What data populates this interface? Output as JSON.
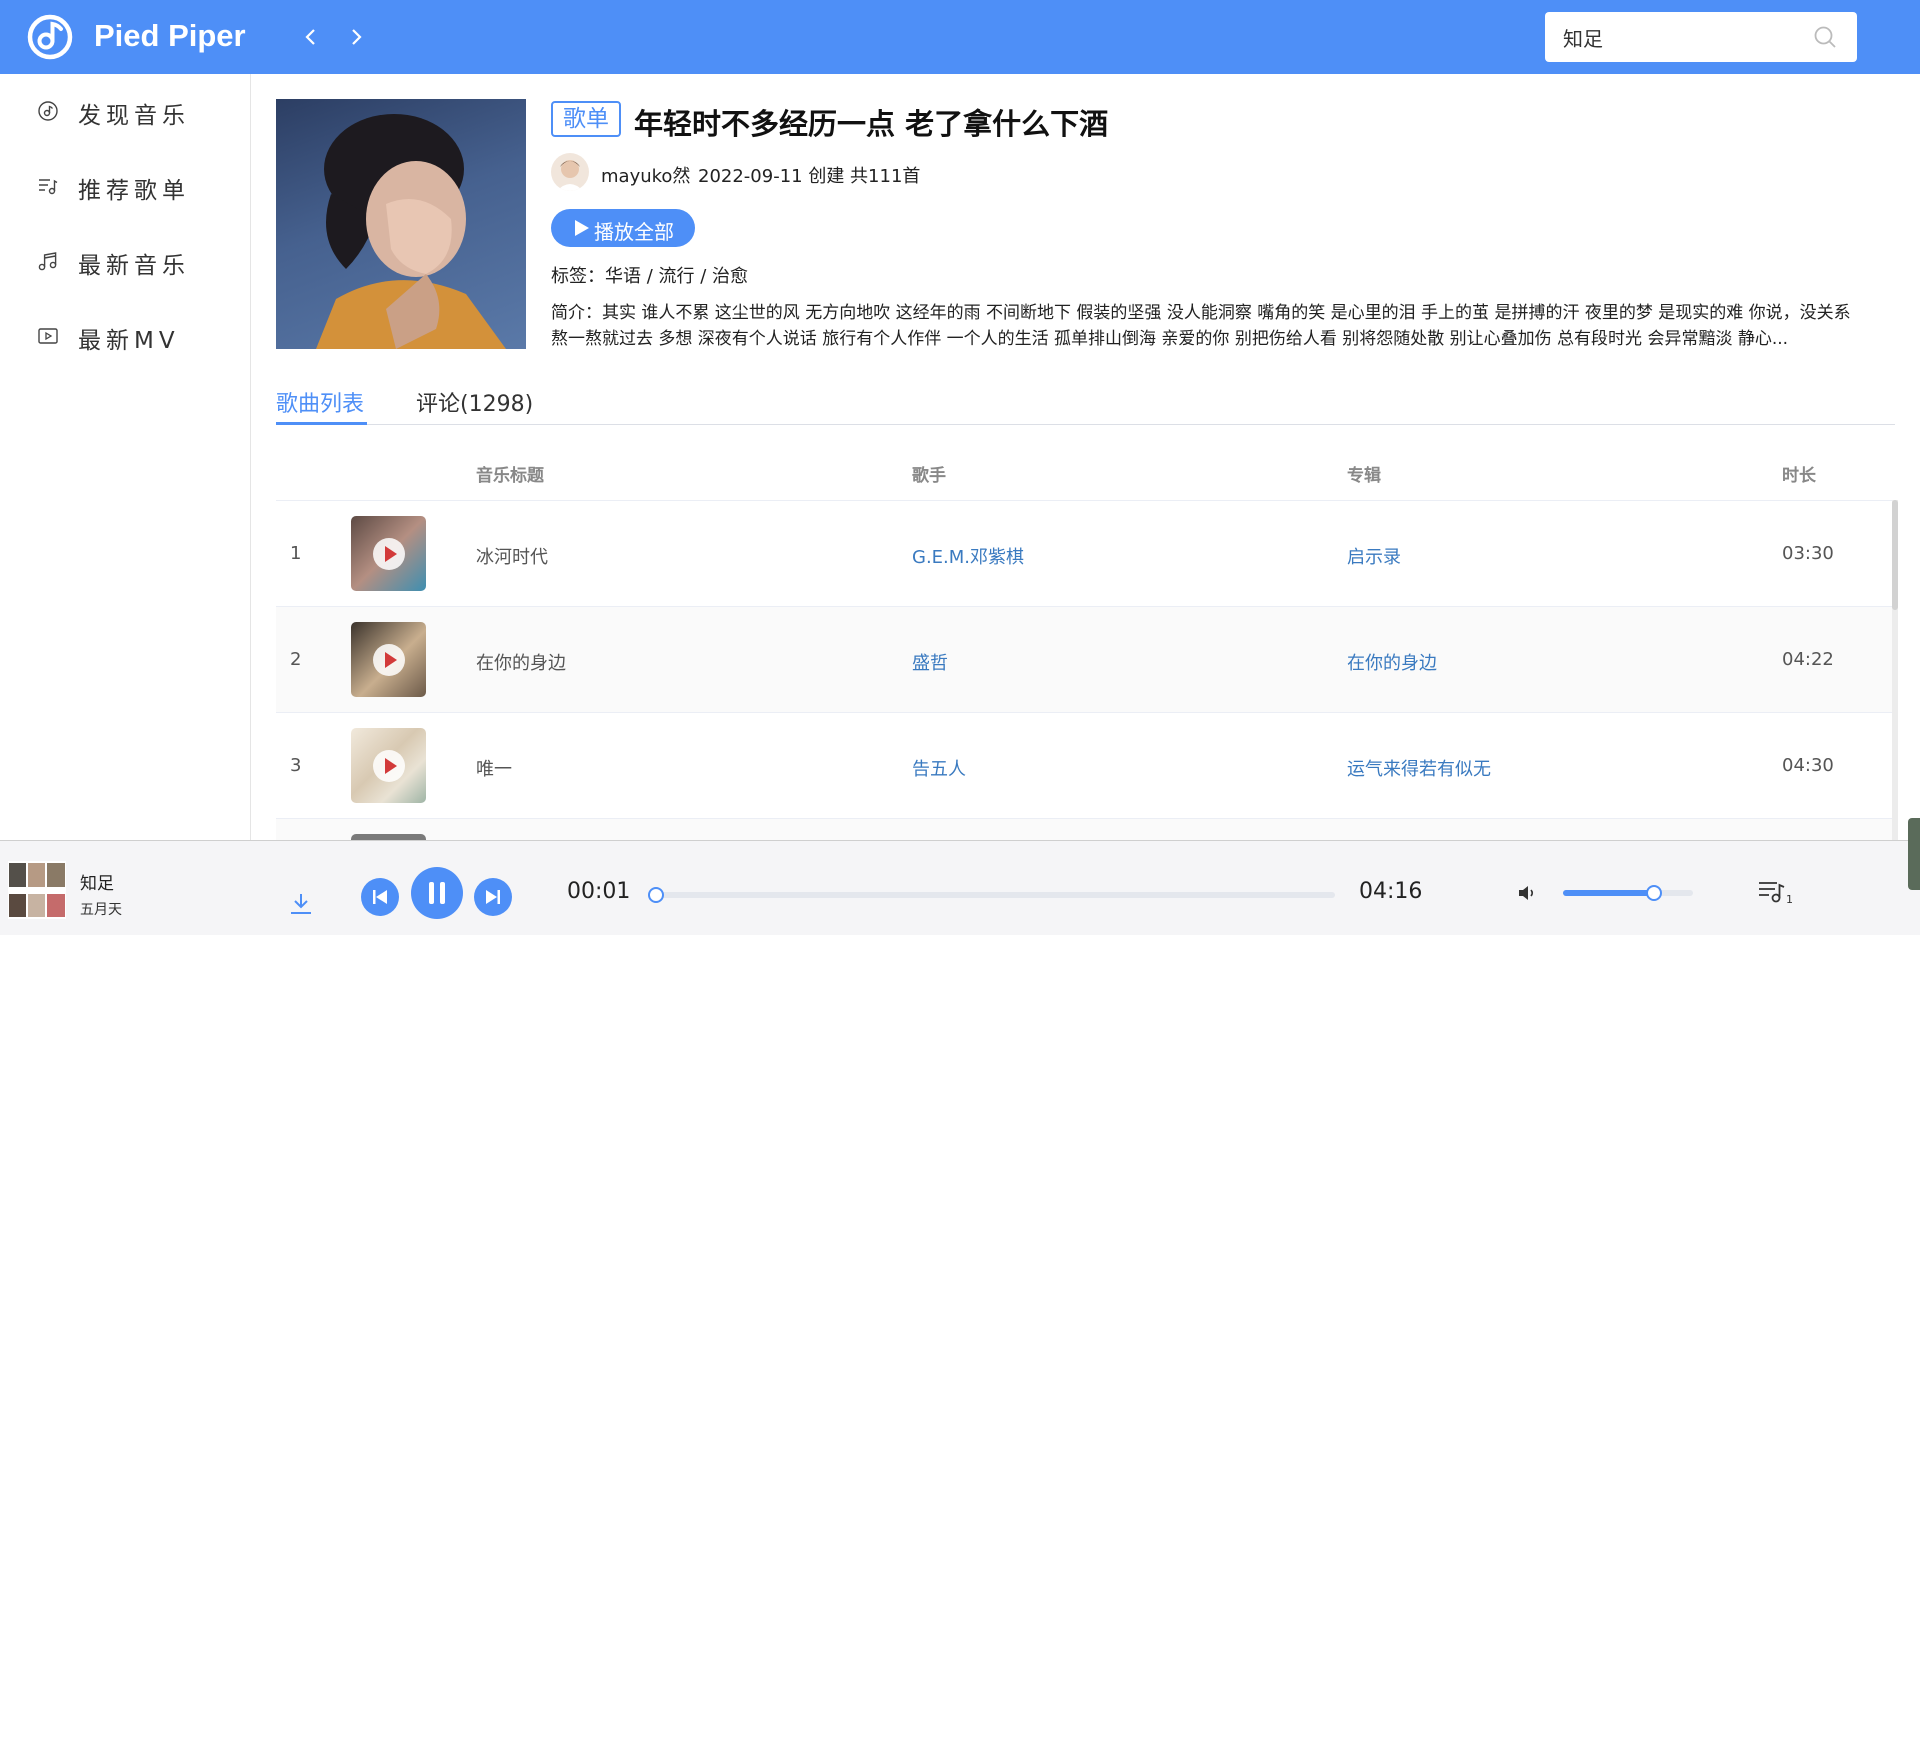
{
  "app": {
    "name": "Pied Piper"
  },
  "search": {
    "value": "知足"
  },
  "sidebar": {
    "items": [
      {
        "label": "发现音乐",
        "icon": "disc-music-icon"
      },
      {
        "label": "推荐歌单",
        "icon": "playlist-icon"
      },
      {
        "label": "最新音乐",
        "icon": "music-note-icon"
      },
      {
        "label": "最新MV",
        "icon": "video-play-icon"
      }
    ]
  },
  "playlist": {
    "badge": "歌单",
    "title": "年轻时不多经历一点 老了拿什么下酒",
    "creator": "mayuko然",
    "create_info": "2022-09-11 创建 共111首",
    "play_all": "播放全部",
    "tags": "标签：华语 / 流行 / 治愈",
    "description": "简介：其实 谁人不累 这尘世的风 无方向地吹 这经年的雨 不间断地下 假装的坚强 没人能洞察 嘴角的笑 是心里的泪 手上的茧 是拼搏的汗 夜里的梦 是现实的难 你说，没关系 熬一熬就过去 多想 深夜有个人说话 旅行有个人作伴 一个人的生活 孤单排山倒海 亲爱的你 别把伤给人看 别将怨随处散 别让心叠加伤 总有段时光 会异常黯淡 静心..."
  },
  "tabs": {
    "songs": "歌曲列表",
    "comments": "评论(1298)"
  },
  "table": {
    "headers": {
      "title": "音乐标题",
      "artist": "歌手",
      "album": "专辑",
      "duration": "时长"
    },
    "rows": [
      {
        "index": "1",
        "title": "冰河时代",
        "artist": "G.E.M.邓紫棋",
        "album": "启示录",
        "duration": "03:30",
        "thumb_color": "#8a6f63"
      },
      {
        "index": "2",
        "title": "在你的身边",
        "artist": "盛哲",
        "album": "在你的身边",
        "duration": "04:22",
        "thumb_color": "#a88f70"
      },
      {
        "index": "3",
        "title": "唯一",
        "artist": "告五人",
        "album": "运气来得若有似无",
        "duration": "04:30",
        "thumb_color": "#e6ddcd"
      }
    ]
  },
  "player": {
    "song": "知足",
    "artist": "五月天",
    "current_time": "00:01",
    "total_time": "04:16",
    "progress": 0.002,
    "volume": 0.7,
    "queue_count": "1"
  },
  "colors": {
    "accent": "#4e8ff7",
    "link": "#3a7ac0"
  }
}
